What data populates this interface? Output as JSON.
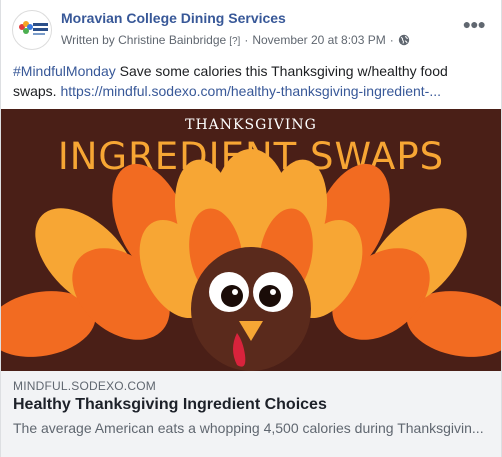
{
  "post": {
    "page_name": "Moravian College Dining Services",
    "author_line": "Written by Christine Bainbridge",
    "author_tag": "[?]",
    "separator": "·",
    "timestamp": "November 20 at 8:03 PM",
    "separator2": "·",
    "privacy_icon": "globe-icon",
    "more_icon": "ellipsis-icon",
    "avatar_text": "DINING SERVICES",
    "hashtag": "#MindfulMonday",
    "text": " Save some calories this Thanksgiving w/healthy food swaps. ",
    "link_text": "https://mindful.sodexo.com/healthy-thanksgiving-ingredient-..."
  },
  "image": {
    "subtitle": "THANKSGIVING",
    "title": "INGREDIENT SWAPS",
    "colors": {
      "background": "#4a1f17",
      "orange": "#f26b21",
      "yellow": "#f7a634",
      "body": "#5a2a1c",
      "wattle": "#d8233c"
    }
  },
  "link_preview": {
    "domain": "MINDFUL.SODEXO.COM",
    "title": "Healthy Thanksgiving Ingredient Choices",
    "description": "The average American eats a whopping 4,500 calories during Thanksgivin..."
  }
}
